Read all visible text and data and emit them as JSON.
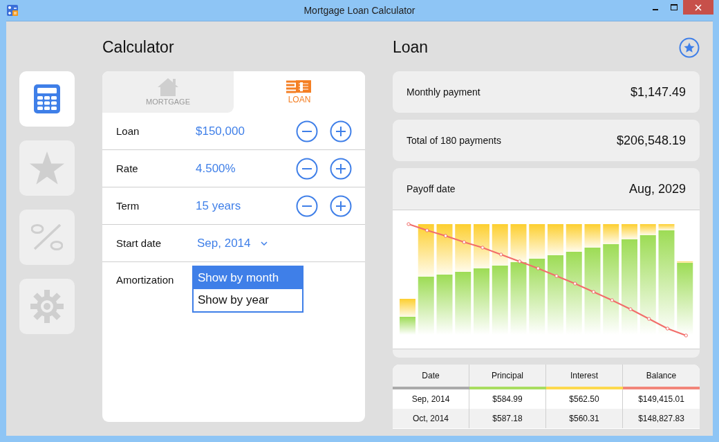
{
  "window": {
    "title": "Mortgage Loan Calculator"
  },
  "sidebar": {
    "items": [
      {
        "kind": "calculator",
        "selected": true
      },
      {
        "kind": "star",
        "selected": false
      },
      {
        "kind": "percent",
        "selected": false
      },
      {
        "kind": "gear",
        "selected": false
      }
    ]
  },
  "calculator": {
    "heading": "Calculator",
    "tabs": [
      {
        "label": "MORTGAGE",
        "kind": "house",
        "selected": false
      },
      {
        "label": "LOAN",
        "kind": "bills",
        "selected": true
      }
    ],
    "fields": [
      {
        "label": "Loan",
        "value": "$150,000",
        "kind": "stepper"
      },
      {
        "label": "Rate",
        "value": "4.500%",
        "kind": "stepper"
      },
      {
        "label": "Term",
        "value": "15 years",
        "kind": "stepper"
      },
      {
        "label": "Start date",
        "value": "Sep, 2014",
        "kind": "dropdown"
      }
    ],
    "amortization": {
      "label": "Amortization",
      "options": [
        {
          "label": "Show by month",
          "selected": true
        },
        {
          "label": "Show by year",
          "selected": false
        }
      ]
    }
  },
  "loan": {
    "heading": "Loan",
    "summary": [
      {
        "label": "Monthly payment",
        "value": "$1,147.49"
      },
      {
        "label": "Total of 180 payments",
        "value": "$206,548.19"
      }
    ],
    "payoff": {
      "label": "Payoff date",
      "value": "Aug, 2029"
    },
    "table": {
      "columns": [
        {
          "label": "Date",
          "color": "#aaaaaa"
        },
        {
          "label": "Principal",
          "color": "#a8dd60"
        },
        {
          "label": "Interest",
          "color": "#fcd94e"
        },
        {
          "label": "Balance",
          "color": "#f2857a"
        }
      ],
      "rows": [
        [
          "Sep, 2014",
          "$584.99",
          "$562.50",
          "$149,415.01"
        ],
        [
          "Oct, 2014",
          "$587.18",
          "$560.31",
          "$148,827.83"
        ]
      ]
    }
  }
}
